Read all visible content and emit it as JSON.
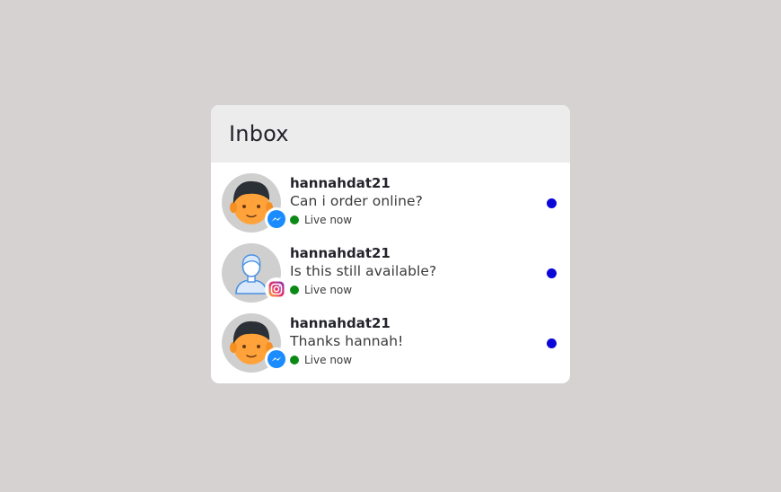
{
  "inbox": {
    "title": "Inbox",
    "conversations": [
      {
        "avatar": "man-face-icon",
        "platform": "messenger-icon",
        "name": "hannahdat21",
        "message": "Can i order online?",
        "status": "Live now",
        "unread": true
      },
      {
        "avatar": "user-outline-icon",
        "platform": "instagram-icon",
        "name": "hannahdat21",
        "message": "Is this still available?",
        "status": "Live now",
        "unread": true
      },
      {
        "avatar": "man-face-icon",
        "platform": "messenger-icon",
        "name": "hannahdat21",
        "message": "Thanks hannah!",
        "status": "Live now",
        "unread": true
      }
    ]
  },
  "colors": {
    "page_background": "#d6d2d2",
    "header_background": "#ececec",
    "live_dot": "#0a8a14",
    "unread_dot": "#0a07d8",
    "messenger_blue": "#1a8cff"
  }
}
